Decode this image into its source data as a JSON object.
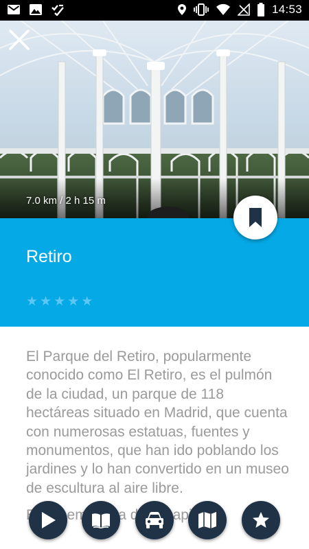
{
  "status_bar": {
    "time": "14:53",
    "left_icons": [
      "gmail-icon",
      "image-icon",
      "checklist-icon"
    ],
    "right_icons": [
      "location-icon",
      "vibrate-icon",
      "wifi-icon",
      "no-signal-icon",
      "battery-icon"
    ]
  },
  "hero": {
    "distance": "7.0 km / 2 h 15 m",
    "close_icon": "close-icon"
  },
  "title_band": {
    "title": "Retiro",
    "rating_stars": 5,
    "rating_value": 0,
    "color": "#05a9e6"
  },
  "description": {
    "paragraph_1": "El Parque del Retiro, popularmente conocido como El Retiro, es el pulmón de la ciudad, un parque de 118 hectáreas situado en Madrid, que cuenta con numerosas estatuas, fuentes y monumentos, que han ido poblando los jardines y lo han convertido en un museo de escultura al aire libre.",
    "paragraph_2": "Es un emblema de la capital"
  },
  "actions": [
    {
      "name": "play-button",
      "icon": "play-icon"
    },
    {
      "name": "guide-button",
      "icon": "book-icon"
    },
    {
      "name": "drive-button",
      "icon": "car-icon"
    },
    {
      "name": "map-button",
      "icon": "map-icon"
    },
    {
      "name": "favorite-button",
      "icon": "star-icon"
    }
  ],
  "colors": {
    "accent": "#05a9e6",
    "action_button": "#1f3246",
    "text_secondary": "#9a9a9a"
  }
}
